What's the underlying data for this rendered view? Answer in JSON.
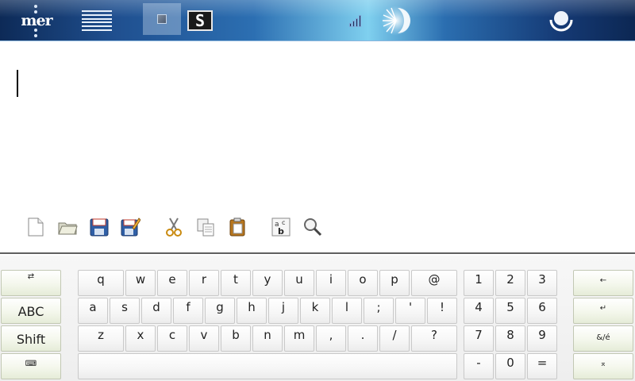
{
  "topbar": {
    "logo": "mer",
    "icons": [
      "menu-icon",
      "app-tab-icon",
      "terminal-icon",
      "signal-icon",
      "brightness-icon",
      "power-icon"
    ],
    "terminal_glyph": "S",
    "colors": {
      "bar_dark": "#0d2a57",
      "bar_light": "#7fd0ef"
    }
  },
  "editor": {
    "text": "",
    "toolbar": [
      "new-document-icon",
      "open-folder-icon",
      "save-icon",
      "save-as-icon",
      "cut-icon",
      "copy-icon",
      "paste-icon",
      "spellcheck-icon",
      "find-icon"
    ]
  },
  "keyboard": {
    "side_left": {
      "row1": "⇄",
      "row2": "ABC",
      "row3": "Shift",
      "row4": "⌨"
    },
    "letters": [
      [
        "q",
        "w",
        "e",
        "r",
        "t",
        "y",
        "u",
        "i",
        "o",
        "p",
        "@"
      ],
      [
        "a",
        "s",
        "d",
        "f",
        "g",
        "h",
        "j",
        "k",
        "l",
        ";",
        "'",
        "!"
      ],
      [
        "z",
        "x",
        "c",
        "v",
        "b",
        "n",
        "m",
        ",",
        ".",
        "/",
        "?"
      ]
    ],
    "numpad": [
      [
        "1",
        "2",
        "3"
      ],
      [
        "4",
        "5",
        "6"
      ],
      [
        "7",
        "8",
        "9"
      ],
      [
        "-",
        "0",
        "="
      ]
    ],
    "side_right": {
      "row1": "←",
      "row2": "↵",
      "row3": "&/é",
      "row4": "⌅"
    }
  }
}
